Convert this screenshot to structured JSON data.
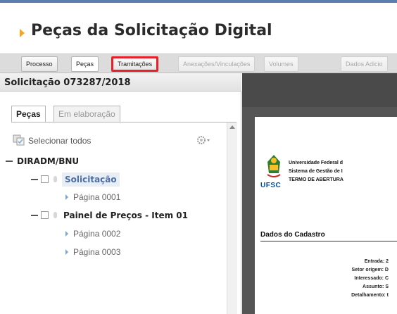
{
  "page_title": "Peças da Solicitação Digital",
  "tabs": [
    {
      "label": "Processo",
      "state": "normal"
    },
    {
      "label": "Peças",
      "state": "active"
    },
    {
      "label": "Tramitações",
      "state": "highlight"
    },
    {
      "label": "Anexações/Vinculações",
      "state": "disabled"
    },
    {
      "label": "Volumes",
      "state": "disabled"
    },
    {
      "label": "Dados Adicio",
      "state": "disabled"
    }
  ],
  "left_panel": {
    "header": "Solicitação 073287/2018",
    "subtabs": [
      {
        "label": "Peças",
        "active": true
      },
      {
        "label": "Em elaboração",
        "active": false
      }
    ],
    "select_all_label": "Selecionar todos",
    "tree": {
      "root": "DIRADM/BNU",
      "nodes": [
        {
          "label": "Solicitação",
          "selected": true,
          "pages": [
            "Página 0001"
          ]
        },
        {
          "label": "Painel de Preços - Item 01",
          "selected": false,
          "pages": [
            "Página 0002",
            "Página 0003"
          ]
        }
      ]
    }
  },
  "document": {
    "logo_text": "UFSC",
    "header_lines": [
      "Universidade Federal d",
      "Sistema de Gestão de I",
      "TERMO DE ABERTURA"
    ],
    "section_title": "Dados do Cadastro",
    "fields": [
      "Entrada: 2",
      "Setor origem: D",
      "Interessado: C",
      "Assunto: S",
      "Detalhamento: t"
    ]
  },
  "colors": {
    "accent_arrow": "#f6a623",
    "highlight_border": "#e8202a",
    "selected_text": "#4a6fa5"
  }
}
